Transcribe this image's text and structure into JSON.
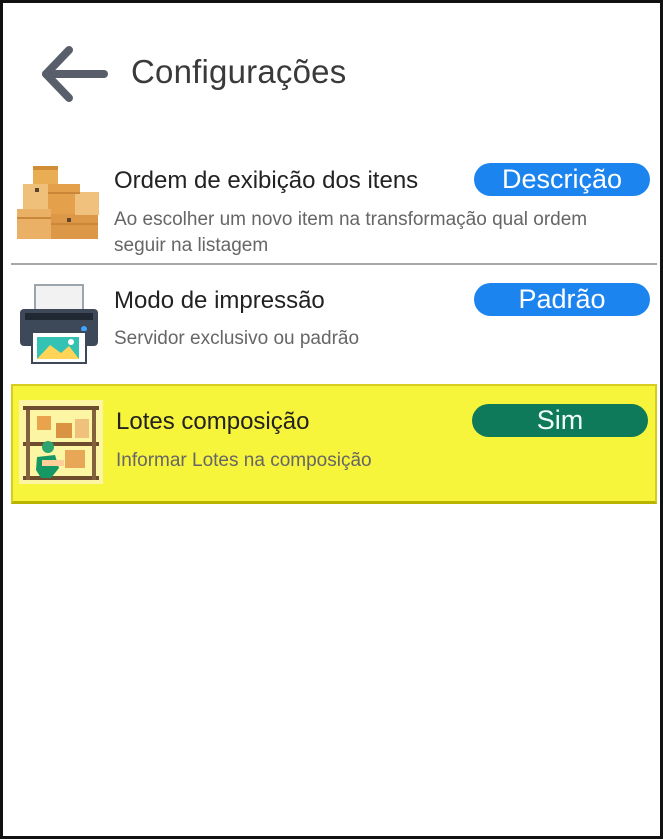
{
  "header": {
    "title": "Configurações",
    "back_icon": "arrow-left-icon"
  },
  "settings": [
    {
      "icon": "boxes-icon",
      "title": "Ordem de exibição dos itens",
      "description": "Ao escolher um novo item na transformação qual ordem seguir na listagem",
      "value": "Descrição",
      "value_color": "#1c84ef"
    },
    {
      "icon": "printer-icon",
      "title": "Modo de impressão",
      "description": "Servidor exclusivo ou padrão",
      "value": "Padrão",
      "value_color": "#1c84ef"
    },
    {
      "icon": "warehouse-worker-icon",
      "title": "Lotes composição",
      "description": "Informar Lotes na composição",
      "value": "Sim",
      "value_color": "#0e7a5a",
      "highlight_color": "#f7f43c"
    }
  ]
}
